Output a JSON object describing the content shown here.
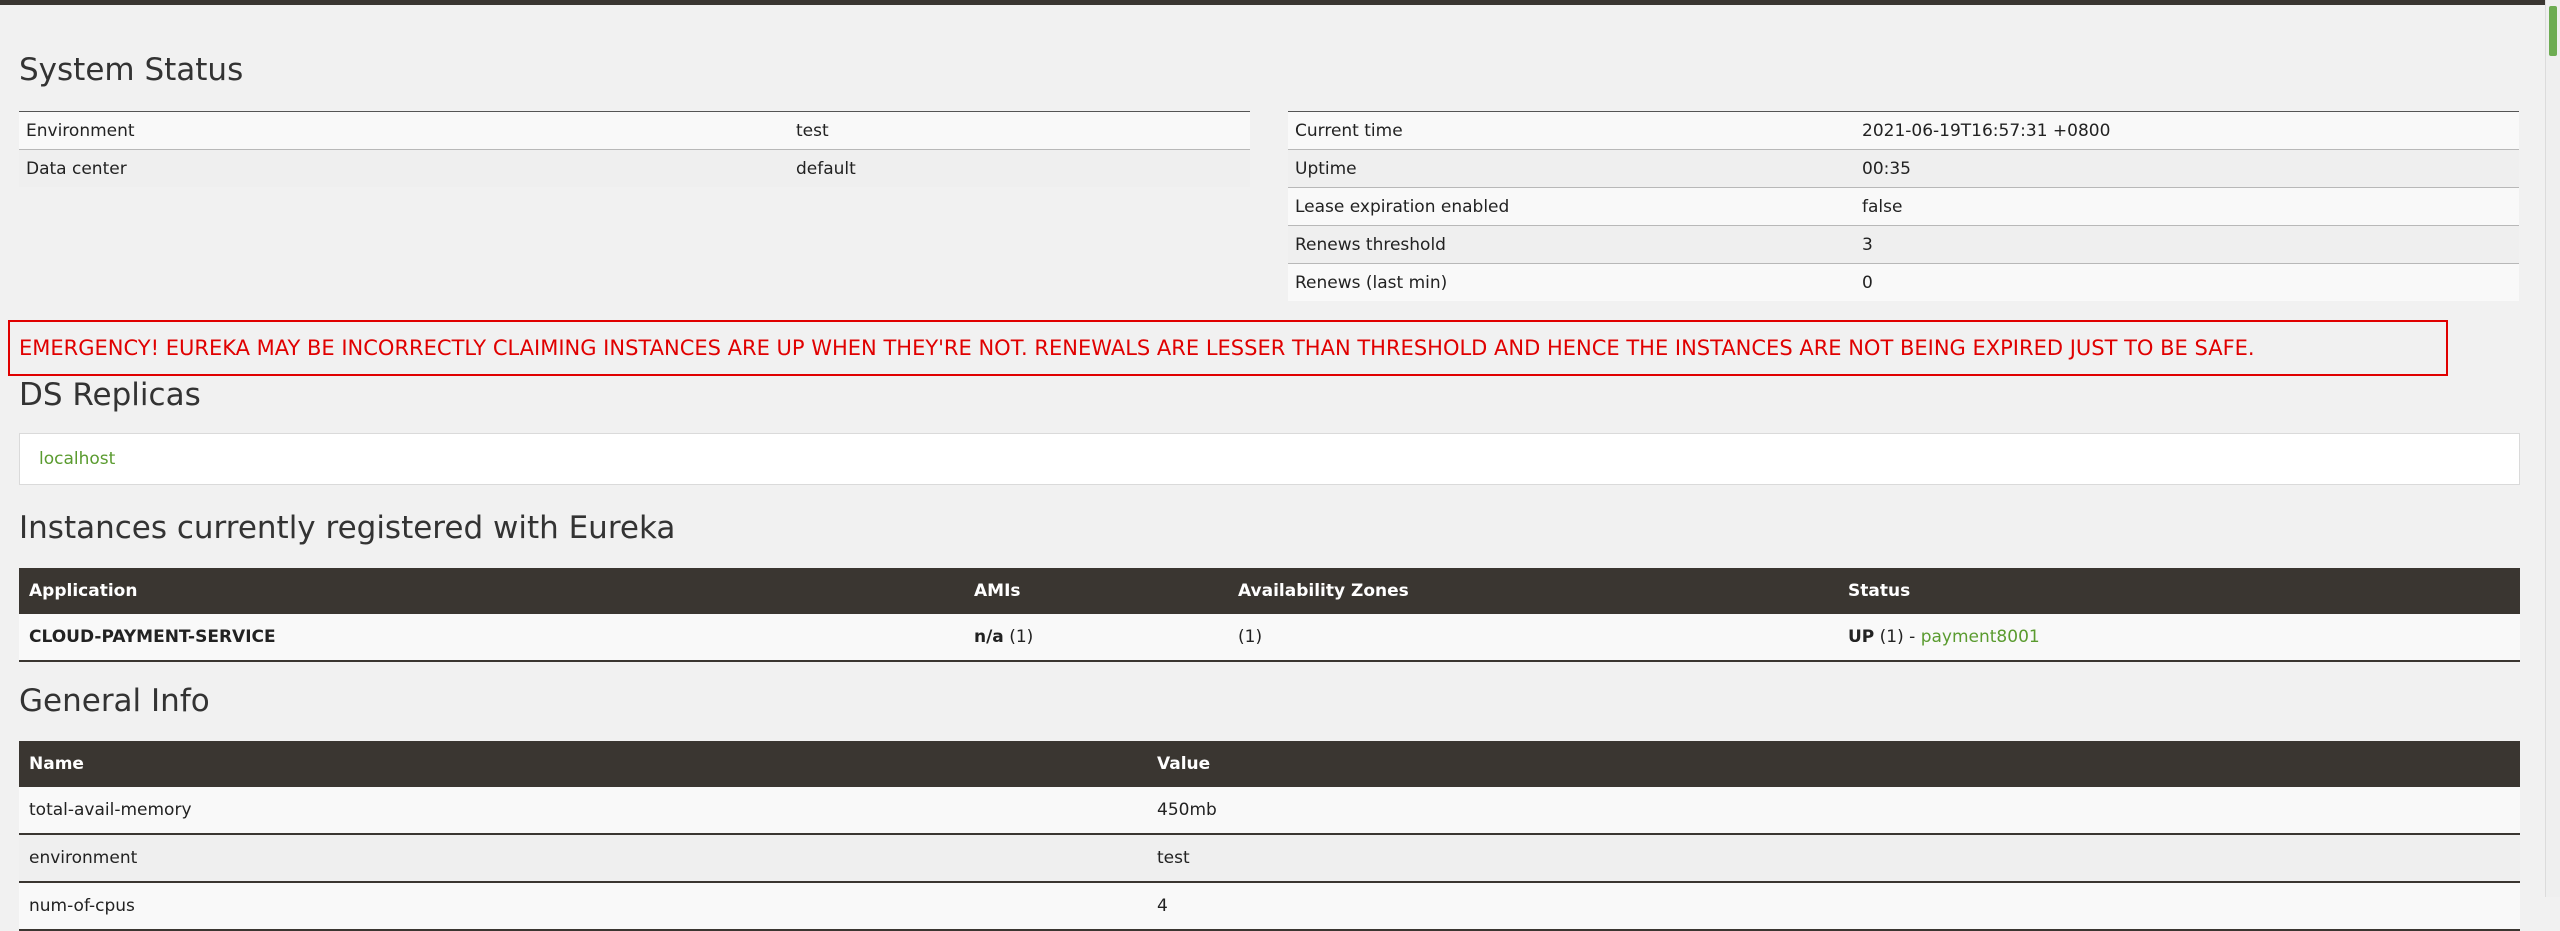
{
  "system_status": {
    "title": "System Status",
    "left": [
      {
        "label": "Environment",
        "value": "test"
      },
      {
        "label": "Data center",
        "value": "default"
      }
    ],
    "right": [
      {
        "label": "Current time",
        "value": "2021-06-19T16:57:31 +0800"
      },
      {
        "label": "Uptime",
        "value": "00:35"
      },
      {
        "label": "Lease expiration enabled",
        "value": "false"
      },
      {
        "label": "Renews threshold",
        "value": "3"
      },
      {
        "label": "Renews (last min)",
        "value": "0"
      }
    ]
  },
  "emergency_message": "EMERGENCY! EUREKA MAY BE INCORRECTLY CLAIMING INSTANCES ARE UP WHEN THEY'RE NOT. RENEWALS ARE LESSER THAN THRESHOLD AND HENCE THE INSTANCES ARE NOT BEING EXPIRED JUST TO BE SAFE.",
  "ds_replicas": {
    "title": "DS Replicas",
    "items": [
      "localhost"
    ]
  },
  "instances": {
    "title": "Instances currently registered with Eureka",
    "columns": [
      "Application",
      "AMIs",
      "Availability Zones",
      "Status"
    ],
    "rows": [
      {
        "application": "CLOUD-PAYMENT-SERVICE",
        "amis_label": "n/a",
        "amis_count": "(1)",
        "zones": "(1)",
        "status_label": "UP",
        "status_count": "(1) -",
        "instance_link": "payment8001"
      }
    ]
  },
  "general_info": {
    "title": "General Info",
    "columns": [
      "Name",
      "Value"
    ],
    "rows": [
      {
        "name": "total-avail-memory",
        "value": "450mb"
      },
      {
        "name": "environment",
        "value": "test"
      },
      {
        "name": "num-of-cpus",
        "value": "4"
      }
    ]
  },
  "colors": {
    "header_bg": "#3a3631",
    "emergency": "#e00000",
    "link": "#5a9b2f",
    "scroll_thumb": "#6dac52"
  }
}
